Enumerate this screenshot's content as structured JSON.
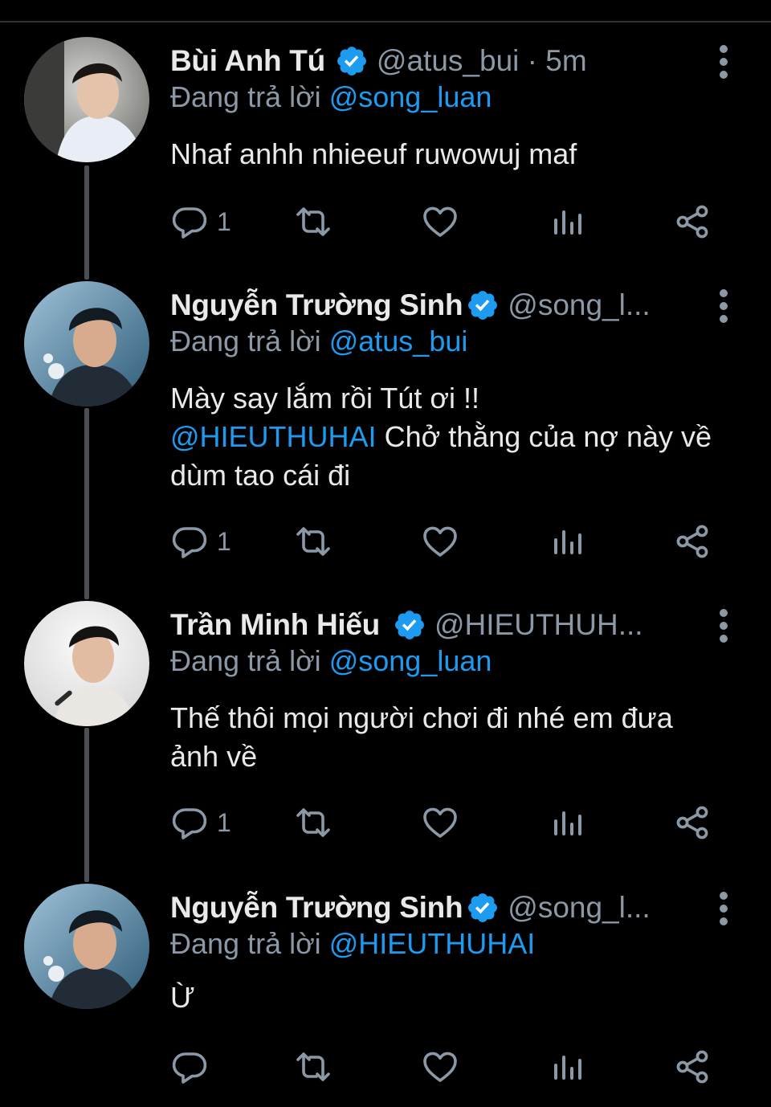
{
  "reply_prefix": "Đang trả lời",
  "colors": {
    "accent": "#1d9bf0",
    "muted": "#8b98a5",
    "text": "#e7e9ea",
    "background": "#000000"
  },
  "tweets": [
    {
      "name": "Bùi Anh Tú",
      "handle": "@atus_bui · 5m",
      "reply_to": "@song_luan",
      "body_plain": "Nhaf anhh nhieeuf ruwowuj maf",
      "reply_count": "1",
      "icons": [
        "reply-icon",
        "retweet-icon",
        "like-icon",
        "analytics-icon",
        "share-icon"
      ]
    },
    {
      "name": "Nguyễn Trường Sinh",
      "handle": "@song_l...",
      "reply_to": "@atus_bui",
      "body_line1": "Mày say lắm rồi Tút ơi !!",
      "body_mention": "@HIEUTHUHAI",
      "body_rest": " Chở thằng của nợ này về dùm tao cái đi",
      "reply_count": "1"
    },
    {
      "name": "Trần Minh Hiếu",
      "handle": "@HIEUTHUH...",
      "reply_to": "@song_luan",
      "body_plain": "Thế thôi mọi người chơi đi nhé em đưa ảnh về",
      "reply_count": "1"
    },
    {
      "name": "Nguyễn Trường Sinh",
      "handle": "@song_l...",
      "reply_to": "@HIEUTHUHAI",
      "body_plain": "Ừ",
      "reply_count": ""
    }
  ]
}
